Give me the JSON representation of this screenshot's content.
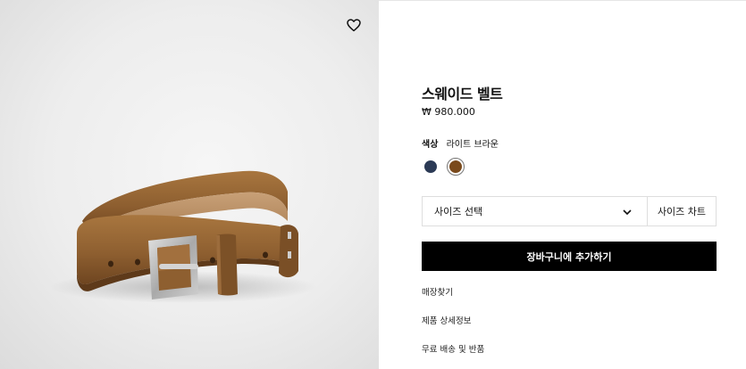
{
  "product": {
    "title": "스웨이드 벨트",
    "price": "₩ 980.000",
    "color_label": "색상",
    "color_value": "라이트 브라운",
    "swatches": [
      {
        "name": "navy",
        "color": "#2b3a55"
      },
      {
        "name": "light-brown",
        "color": "#7a4a1c",
        "selected": true
      }
    ]
  },
  "size": {
    "select_label": "사이즈 선택",
    "chart_label": "사이즈 차트"
  },
  "actions": {
    "add_to_cart": "장바구니에 추가하기"
  },
  "links": {
    "store_finder": "매장찾기",
    "product_details": "제품 상세정보",
    "shipping_returns": "무료 배송 및 반품"
  },
  "colors": {
    "button_bg": "#000000",
    "belt_suede": "#9a6a3a",
    "buckle": "#b9b9b9"
  }
}
